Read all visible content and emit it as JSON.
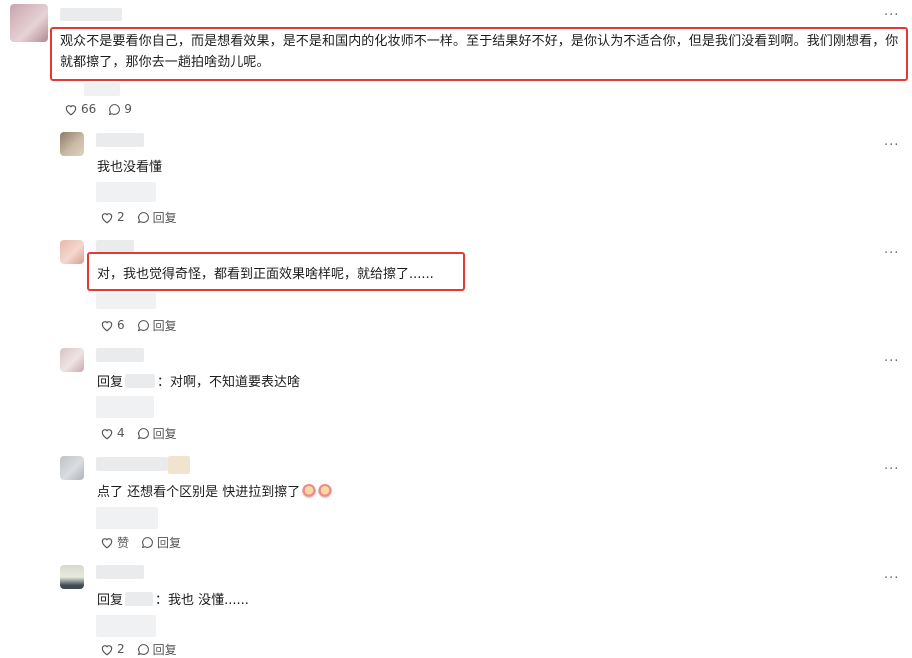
{
  "comments": [
    {
      "text": "观众不是要看你自己，而是想看效果，是不是和国内的化妆师不一样。至于结果好不好，是你认为不适合你，但是我们没看到啊。我们刚想看，你就都擦了，那你去一趟拍啥劲儿呢。",
      "likes": "66",
      "replies": "9"
    }
  ],
  "replies": [
    {
      "text": "我也没看懂",
      "likes": "2",
      "reply_label": "回复"
    },
    {
      "text": "对，我也觉得奇怪，都看到正面效果啥样呢，就给擦了......",
      "likes": "6",
      "reply_label": "回复"
    },
    {
      "prefix": "回复",
      "text": "：对啊，不知道要表达啥",
      "likes": "4",
      "reply_label": "回复"
    },
    {
      "text": "点了 还想看个区别是 快进拉到擦了",
      "likes": "赞",
      "reply_label": "回复"
    },
    {
      "prefix": "回复",
      "text": "：我也 没懂......",
      "likes": "2",
      "reply_label": "回复"
    }
  ],
  "more_label": "···",
  "colors": {
    "highlight": "#e53935"
  }
}
